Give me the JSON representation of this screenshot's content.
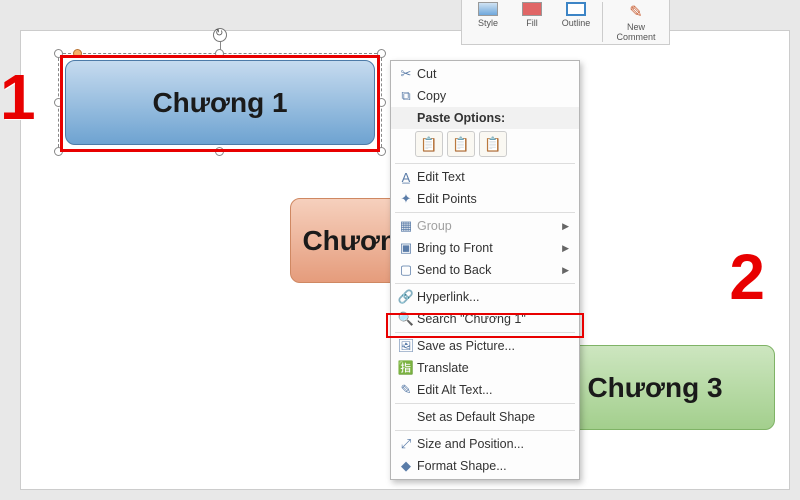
{
  "ribbon": {
    "style_label": "Style",
    "fill_label": "Fill",
    "outline_label": "Outline",
    "comment_label": "New Comment"
  },
  "annotations": {
    "num1": "1",
    "num2": "2"
  },
  "shapes": {
    "s1": "Chương 1",
    "s2": "Chương 2",
    "s3": "Chương 3"
  },
  "context_menu": {
    "cut": "Cut",
    "copy": "Copy",
    "paste_options": "Paste Options:",
    "edit_text": "Edit Text",
    "edit_points": "Edit Points",
    "group": "Group",
    "bring_front": "Bring to Front",
    "send_back": "Send to Back",
    "hyperlink": "Hyperlink...",
    "search": "Search \"Chương 1\"",
    "save_picture": "Save as Picture...",
    "translate": "Translate",
    "edit_alt": "Edit Alt Text...",
    "set_default": "Set as Default Shape",
    "size_position": "Size and Position...",
    "format_shape": "Format Shape..."
  }
}
